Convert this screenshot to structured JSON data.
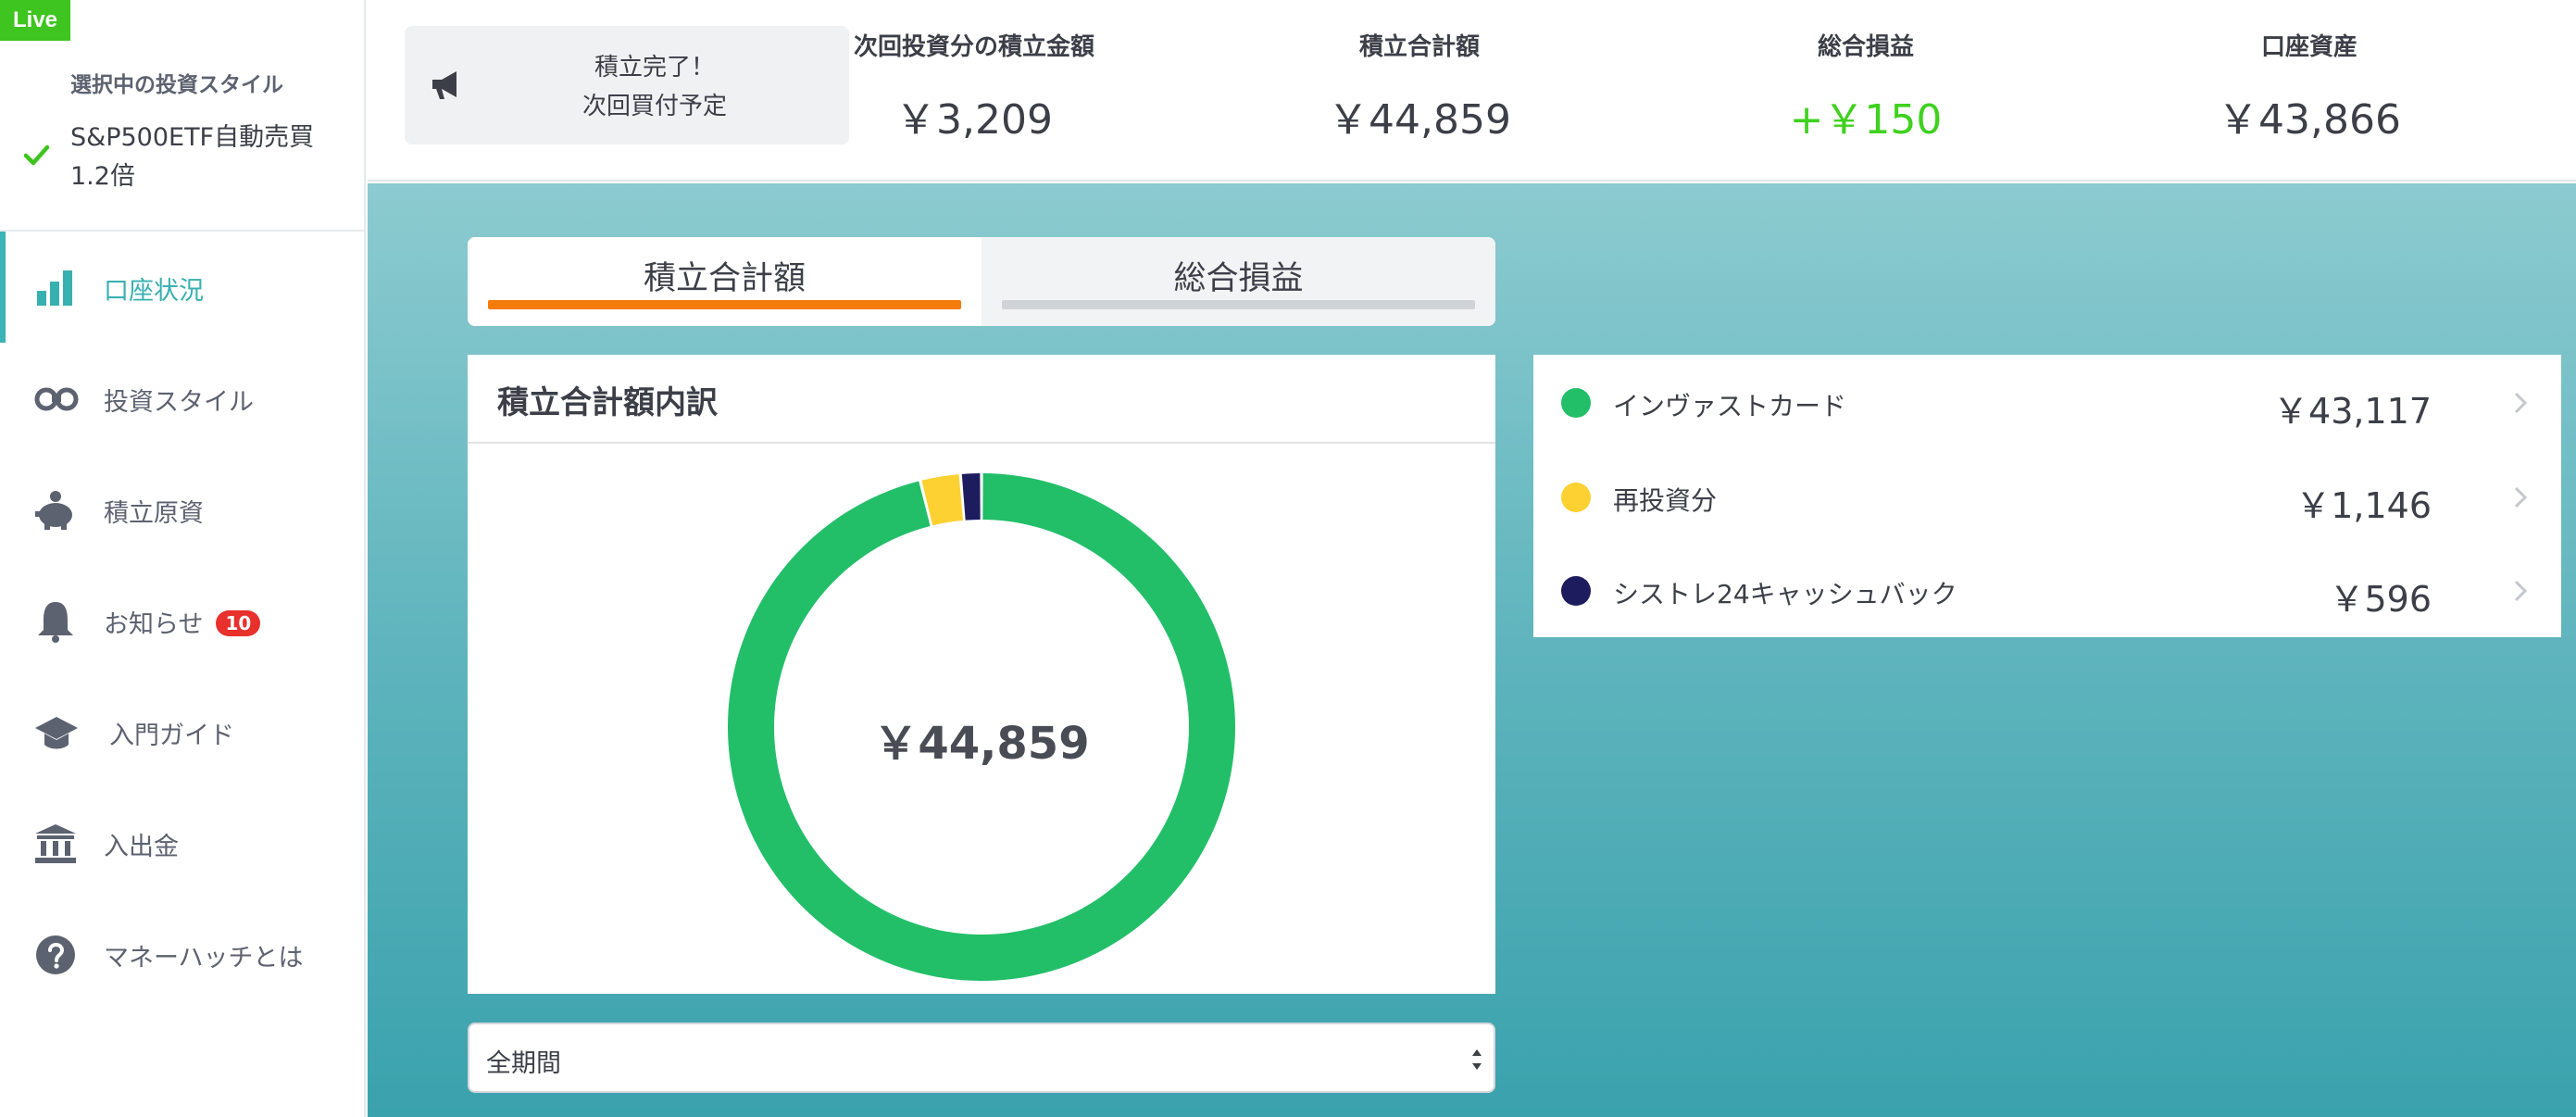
{
  "sidebar": {
    "live_badge": "Live",
    "style_label": "選択中の投資スタイル",
    "style_name": "S&P500ETF自動売買1.2倍",
    "items": [
      {
        "label": "口座状況",
        "icon": "bar-chart-icon",
        "active": true
      },
      {
        "label": "投資スタイル",
        "icon": "binoculars-icon"
      },
      {
        "label": "積立原資",
        "icon": "piggy-bank-icon"
      },
      {
        "label": "お知らせ",
        "icon": "bell-icon",
        "badge": "10"
      },
      {
        "label": "入門ガイド",
        "icon": "graduation-cap-icon"
      },
      {
        "label": "入出金",
        "icon": "bank-icon"
      },
      {
        "label": "マネーハッチとは",
        "icon": "question-circle-icon"
      }
    ]
  },
  "header": {
    "notice_line1": "積立完了！",
    "notice_line2": "次回買付予定",
    "stats": [
      {
        "label": "次回投資分の積立金額",
        "value": "￥3,209"
      },
      {
        "label": "積立合計額",
        "value": "￥44,859"
      },
      {
        "label": "総合損益",
        "value": "+￥150"
      },
      {
        "label": "口座資産",
        "value": "￥43,866"
      }
    ]
  },
  "tabs": {
    "total": "積立合計額",
    "pl": "総合損益"
  },
  "breakdown": {
    "title": "積立合計額内訳",
    "center_value": "￥44,859"
  },
  "chart_data": {
    "type": "pie",
    "categories": [
      "インヴァストカード",
      "再投資分",
      "シストレ24キャッシュバック"
    ],
    "values": [
      43117,
      1146,
      596
    ],
    "colors": [
      "#22bf68",
      "#fdd131",
      "#1d1c5e"
    ]
  },
  "legend": [
    {
      "name": "インヴァストカード",
      "value": "￥43,117",
      "color": "#22bf68"
    },
    {
      "name": "再投資分",
      "value": "￥1,146",
      "color": "#fdd131"
    },
    {
      "name": "シストレ24キャッシュバック",
      "value": "￥596",
      "color": "#1d1c5e"
    }
  ],
  "period": {
    "selected": "全期間"
  },
  "colors": {
    "accent": "#38b0b0",
    "tab_active": "#f57c0a",
    "positive": "#3fd11e",
    "live": "#3ec51f"
  }
}
